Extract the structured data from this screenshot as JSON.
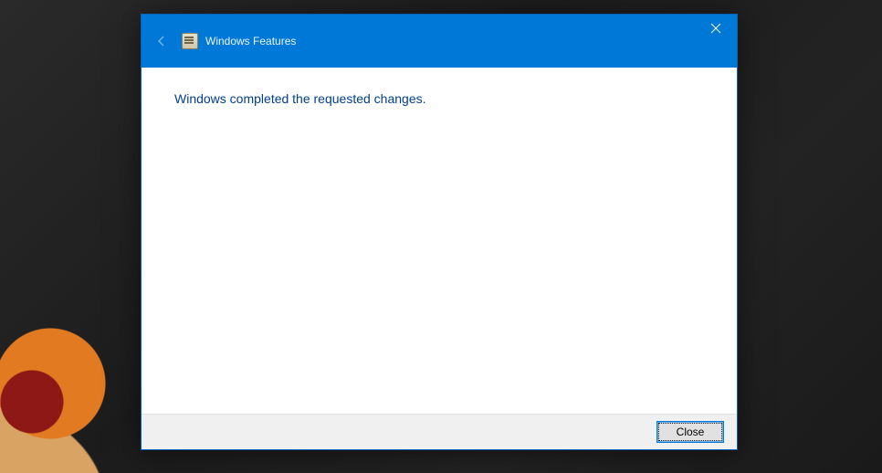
{
  "dialog": {
    "title": "Windows Features",
    "message": "Windows completed the requested changes.",
    "close_button": "Close"
  }
}
